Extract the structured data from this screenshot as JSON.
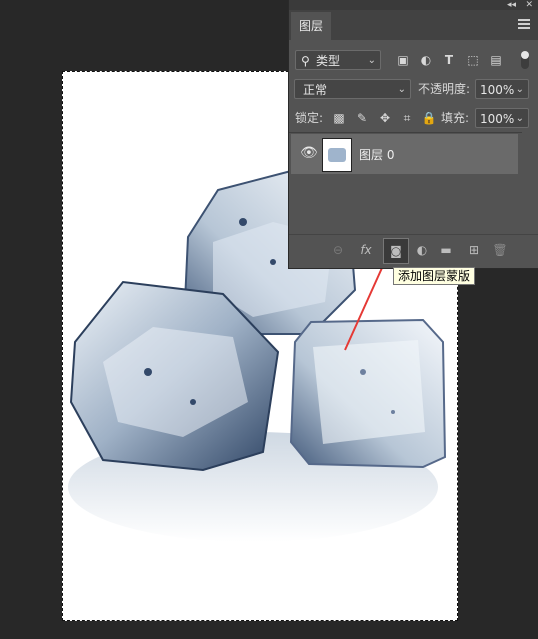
{
  "panel": {
    "tab_label": "图层",
    "filter_label": "类型",
    "blend_mode": "正常",
    "opacity_label": "不透明度:",
    "opacity_value": "100%",
    "lock_label": "锁定:",
    "fill_label": "填充:",
    "fill_value": "100%"
  },
  "layers": [
    {
      "name": "图层 0",
      "visible": true
    }
  ],
  "tooltip": "添加图层蒙版",
  "icons": {
    "top": [
      "collapse-icon",
      "close-icon",
      "panel-menu-icon"
    ],
    "filter": [
      "image-filter-icon",
      "adjustment-filter-icon",
      "type-filter-icon",
      "shape-filter-icon",
      "smart-object-filter-icon",
      "filter-toggle-icon"
    ],
    "lock": [
      "lock-transparent-icon",
      "lock-pixels-icon",
      "lock-position-icon",
      "lock-artboard-icon",
      "lock-all-icon"
    ],
    "bottom": [
      "link-layers-icon",
      "layer-style-icon",
      "add-mask-icon",
      "adjustment-layer-icon",
      "group-icon",
      "new-layer-icon",
      "delete-icon"
    ]
  },
  "colors": {
    "panel": "#535353",
    "selected_row": "#6a6a6a",
    "background": "#282828",
    "tooltip_bg": "#ffffe1",
    "arrow": "#e53935"
  }
}
